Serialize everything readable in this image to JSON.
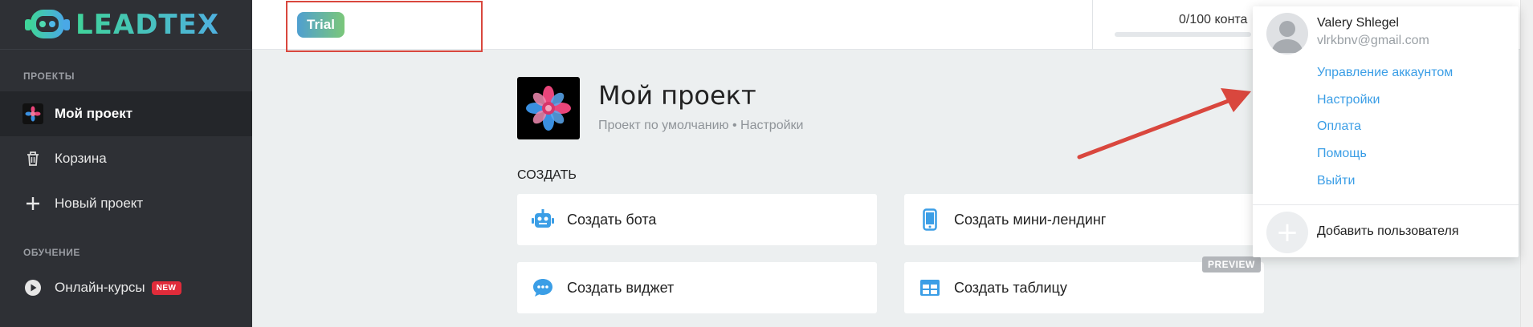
{
  "app": {
    "logo_text": "LEADTEX",
    "accent": "#3b9ee6"
  },
  "sidebar": {
    "sections": [
      {
        "title": "ПРОЕКТЫ"
      },
      {
        "title": "ОБУЧЕНИЕ"
      }
    ],
    "items": [
      {
        "label": "Мой проект",
        "icon": "project-flower-icon",
        "active": true
      },
      {
        "label": "Корзина",
        "icon": "trash-icon"
      },
      {
        "label": "Новый проект",
        "icon": "plus-icon"
      },
      {
        "label": "Онлайн-курсы",
        "icon": "play-circle-icon",
        "badge": "NEW"
      }
    ]
  },
  "topbar": {
    "plan_badge": "Trial",
    "contacts_text": "0/100 конта",
    "contacts_used": 0,
    "contacts_limit": 100
  },
  "project": {
    "title": "Мой проект",
    "subtitle": "Проект по умолчанию • Настройки"
  },
  "create": {
    "label": "СОЗДАТЬ",
    "cards": [
      {
        "label": "Создать бота",
        "icon": "robot-icon"
      },
      {
        "label": "Создать мини-лендинг",
        "icon": "mobile-icon"
      },
      {
        "label": "Создать виджет",
        "icon": "chat-bubble-icon"
      },
      {
        "label": "Создать таблицу",
        "icon": "table-icon",
        "tag": "PREVIEW"
      }
    ]
  },
  "user_menu": {
    "name": "Valery Shlegel",
    "email": "vlrkbnv@gmail.com",
    "links": [
      "Управление аккаунтом",
      "Настройки",
      "Оплата",
      "Помощь",
      "Выйти"
    ],
    "add_user": "Добавить пользователя"
  }
}
